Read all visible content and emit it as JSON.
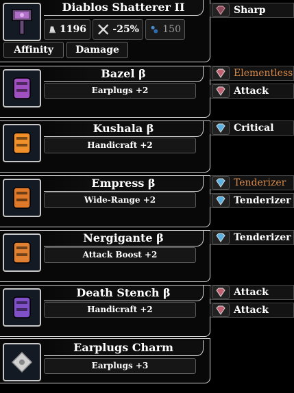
{
  "weapon": {
    "name": "Diablos Shatterer II",
    "attack": "1196",
    "affinity_value": "-25%",
    "element_value": "150",
    "buttons": {
      "affinity": "Affinity",
      "damage": "Damage"
    },
    "decoration": "Sharp"
  },
  "armor": [
    {
      "name": "Bazel β",
      "skill": "Earplugs +2",
      "decorations": [
        {
          "label": "Elementless",
          "color": "#d98a4a"
        },
        {
          "label": "Attack"
        }
      ]
    },
    {
      "name": "Kushala β",
      "skill": "Handicraft +2",
      "decorations": [
        {
          "label": "Critical"
        }
      ]
    },
    {
      "name": "Empress β",
      "skill": "Wide-Range +2",
      "decorations": [
        {
          "label": "Tenderizer",
          "color": "#d98a4a"
        },
        {
          "label": "Tenderizer"
        }
      ]
    },
    {
      "name": "Nergigante β",
      "skill": "Attack Boost +2",
      "decorations": [
        {
          "label": "Tenderizer"
        }
      ]
    },
    {
      "name": "Death Stench β",
      "skill": "Handicraft +2",
      "decorations": [
        {
          "label": "Attack"
        },
        {
          "label": "Attack"
        }
      ]
    }
  ],
  "charm": {
    "name": "Earplugs Charm",
    "skill": "Earplugs +3"
  }
}
